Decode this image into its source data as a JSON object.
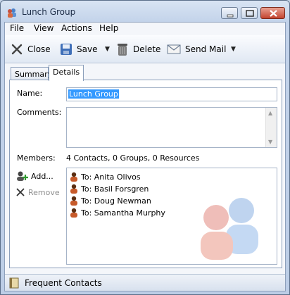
{
  "window": {
    "title": "Lunch Group",
    "icon": "contact-group-icon"
  },
  "menu": {
    "file": "File",
    "view": "View",
    "actions": "Actions",
    "help": "Help"
  },
  "toolbar": {
    "close_label": "Close",
    "save_label": "Save",
    "delete_label": "Delete",
    "send_mail_label": "Send Mail"
  },
  "tabs": [
    {
      "label": "Summary"
    },
    {
      "label": "Details"
    }
  ],
  "form": {
    "name_label": "Name:",
    "name_value": "Lunch Group",
    "comments_label": "Comments:",
    "comments_value": "",
    "members_label": "Members:",
    "members_summary": "4 Contacts, 0 Groups, 0 Resources",
    "add_label": "Add...",
    "remove_label": "Remove"
  },
  "members": [
    {
      "label": "To: Anita Olivos"
    },
    {
      "label": "To: Basil Forsgren"
    },
    {
      "label": "To: Doug Newman"
    },
    {
      "label": "To: Samantha Murphy"
    }
  ],
  "statusbar": {
    "label": "Frequent Contacts"
  },
  "colors": {
    "accent": "#3399ff",
    "titlebar": "#c3d3ea",
    "close_button": "#c3442f"
  }
}
